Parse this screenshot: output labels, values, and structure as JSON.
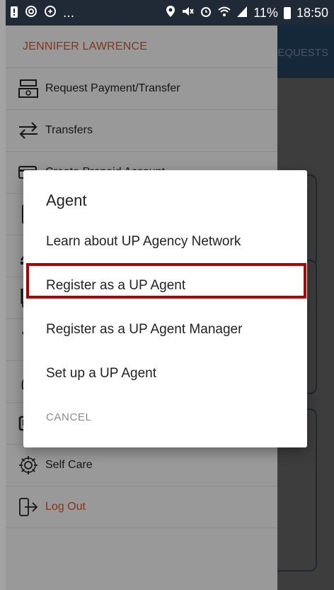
{
  "status_bar": {
    "battery_percent": "11%",
    "time": "18:50",
    "overflow_dots": "...",
    "left_icons": [
      "notification-icon",
      "alarm-icon",
      "at-icon"
    ],
    "right_icons": [
      "location-icon",
      "mute-icon",
      "alarm-icon",
      "wifi-icon",
      "signal-icon",
      "battery-icon"
    ]
  },
  "background_app": {
    "tab_label": "EQUESTS"
  },
  "drawer": {
    "user_name": "JENNIFER LAWRENCE",
    "items": [
      {
        "label": "Request Payment/Transfer",
        "icon": "cash-register-icon"
      },
      {
        "label": "Transfers",
        "icon": "transfer-arrows-icon"
      },
      {
        "label": "",
        "icon": "card-icon"
      },
      {
        "label": "",
        "icon": "phone-icon"
      },
      {
        "label": "",
        "icon": "hand-coin-icon"
      },
      {
        "label": "",
        "icon": "trolley-icon"
      },
      {
        "label": "",
        "icon": "plant-icon"
      },
      {
        "label": "",
        "icon": "map-icon"
      },
      {
        "label": "",
        "icon": "id-card-icon"
      },
      {
        "label": "Self Care",
        "icon": "gear-icon"
      },
      {
        "label": "Log Out",
        "icon": "logout-icon"
      }
    ],
    "partial_text": "Create Prepaid Account"
  },
  "dialog": {
    "title": "Agent",
    "options": [
      "Learn about UP Agency Network",
      "Register as a UP Agent",
      "Register as a UP Agent Manager",
      "Set up a UP Agent"
    ],
    "cancel_label": "CANCEL"
  },
  "colors": {
    "status_bar": "#1f2a36",
    "app_header": "#1f3c57",
    "accent_orange": "#c4502a",
    "highlight_red": "#b00000"
  }
}
